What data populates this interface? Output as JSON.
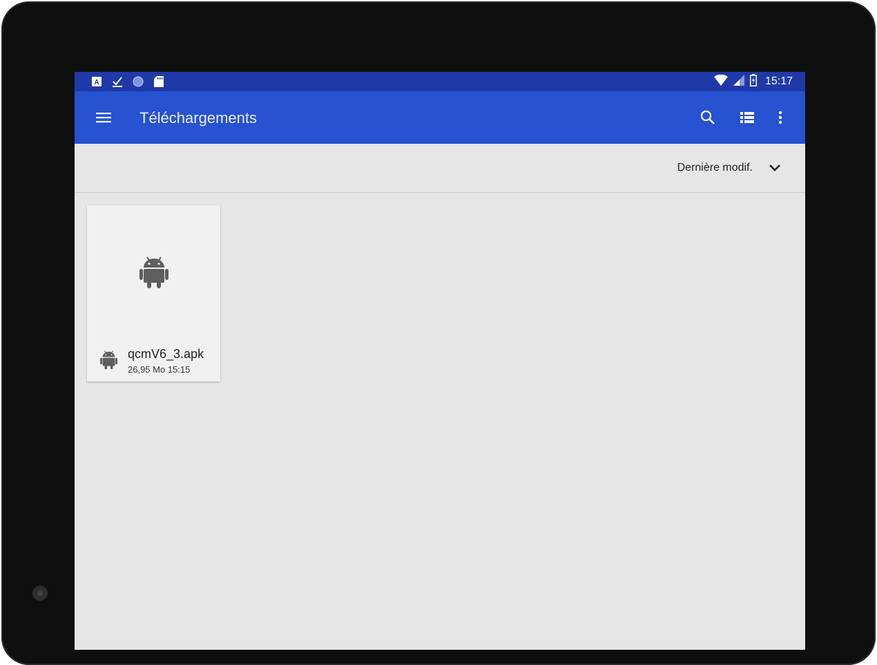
{
  "status_bar": {
    "time": "15:17",
    "left_icons": [
      "text-a-icon",
      "download-done-icon",
      "circle-icon",
      "sd-card-icon"
    ],
    "right_icons": [
      "wifi-icon",
      "cellular-signal-icon",
      "battery-charging-icon"
    ]
  },
  "app_bar": {
    "title": "Téléchargements",
    "icons": [
      "menu-icon",
      "search-icon",
      "list-view-icon",
      "more-vert-icon"
    ],
    "color": "#2752d0"
  },
  "sort_bar": {
    "label": "Dernière modif.",
    "icon": "chevron-down-icon"
  },
  "files": [
    {
      "name": "qcmV6_3.apk",
      "meta": "26,95 Mo 15:15",
      "icon": "android-icon"
    }
  ],
  "colors": {
    "status_bar": "#2039a8",
    "app_bar": "#2752d0",
    "background": "#e6e6e6",
    "icon_gray": "#5f5f5f"
  }
}
